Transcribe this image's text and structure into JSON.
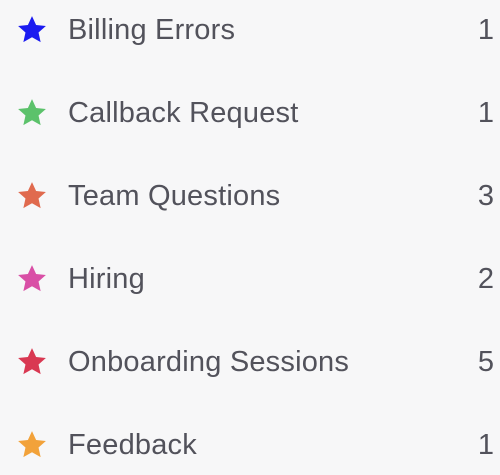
{
  "labels": {
    "items": [
      {
        "label": "Billing Errors",
        "count": "1",
        "icon": "star-icon",
        "color": "#1b1bf0"
      },
      {
        "label": "Callback Request",
        "count": "1",
        "icon": "star-icon",
        "color": "#5cc26b"
      },
      {
        "label": "Team Questions",
        "count": "3",
        "icon": "star-icon",
        "color": "#e06a4e"
      },
      {
        "label": "Hiring",
        "count": "2",
        "icon": "star-icon",
        "color": "#d94fa6"
      },
      {
        "label": "Onboarding Sessions",
        "count": "5",
        "icon": "star-icon",
        "color": "#d93852"
      },
      {
        "label": "Feedback",
        "count": "1",
        "icon": "star-icon",
        "color": "#f2a23a"
      }
    ]
  }
}
